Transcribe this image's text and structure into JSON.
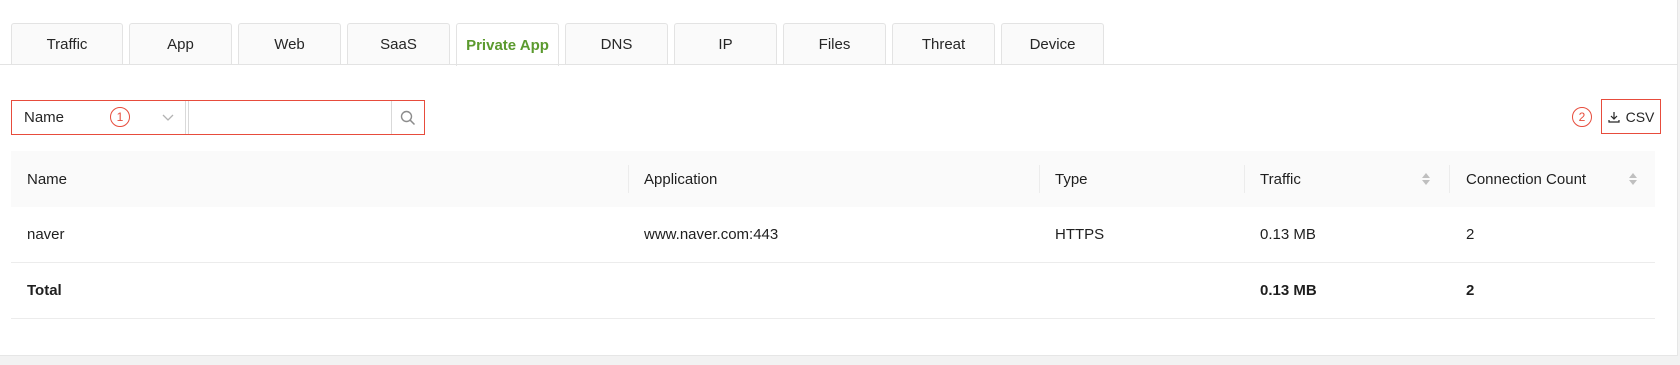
{
  "tabs": [
    {
      "label": "Traffic",
      "width": 101
    },
    {
      "label": "App",
      "width": 103
    },
    {
      "label": "Web",
      "width": 103
    },
    {
      "label": "SaaS",
      "width": 103
    },
    {
      "label": "Private App",
      "width": 103
    },
    {
      "label": "DNS",
      "width": 103
    },
    {
      "label": "IP",
      "width": 103
    },
    {
      "label": "Files",
      "width": 103
    },
    {
      "label": "Threat",
      "width": 103
    },
    {
      "label": "Device",
      "width": 103
    }
  ],
  "search": {
    "field_selected": "Name",
    "input_value": "",
    "input_placeholder": "",
    "annotation_1": "1"
  },
  "export": {
    "csv_label": "CSV",
    "annotation_2": "2"
  },
  "table": {
    "headers": [
      "Name",
      "Application",
      "Type",
      "Traffic",
      "Connection Count"
    ],
    "rows": [
      {
        "name": "naver",
        "application": "www.naver.com:443",
        "type": "HTTPS",
        "traffic": "0.13 MB",
        "connections": "2"
      }
    ],
    "total": {
      "label": "Total",
      "traffic": "0.13 MB",
      "connections": "2"
    }
  },
  "colors": {
    "active_tab": "#5b9a2e",
    "annotation": "#e74c3c"
  }
}
